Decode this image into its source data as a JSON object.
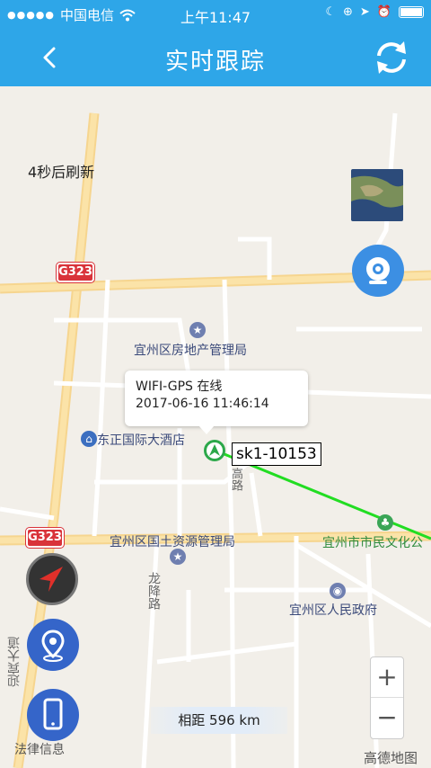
{
  "status_bar": {
    "carrier": "中国电信",
    "time": "上午11:47"
  },
  "nav": {
    "title": "实时跟踪"
  },
  "map": {
    "refresh_note": "4秒后刷新",
    "road_shields": [
      "G323",
      "G323"
    ],
    "pois": {
      "real_estate_bureau": "宜州区房地产管理局",
      "hotel": "东正国际大酒店",
      "land_bureau": "宜州区国土资源管理局",
      "culture_park": "宜州市市民文化公",
      "government": "宜州区人民政府"
    },
    "roads": {
      "longjiang_road": "龙降路",
      "road_fragment": "高路",
      "yingbin_avenue": "迎宾大道"
    },
    "popup": {
      "line1": "WIFI-GPS 在线",
      "line2": "2017-06-16 11:46:14"
    },
    "device_label": "sk1-10153",
    "distance": "相距 596 km",
    "provider": "高德地图",
    "legal": "法律信息"
  },
  "icons": {
    "back": "chevron-left-icon",
    "refresh": "refresh-icon",
    "camera": "camera-icon",
    "compass": "navigation-arrow-icon",
    "location": "location-pin-icon",
    "phone": "phone-icon"
  },
  "colors": {
    "header": "#2ea6e8",
    "track_line": "#22dd22",
    "button_blue": "#3565c9"
  }
}
